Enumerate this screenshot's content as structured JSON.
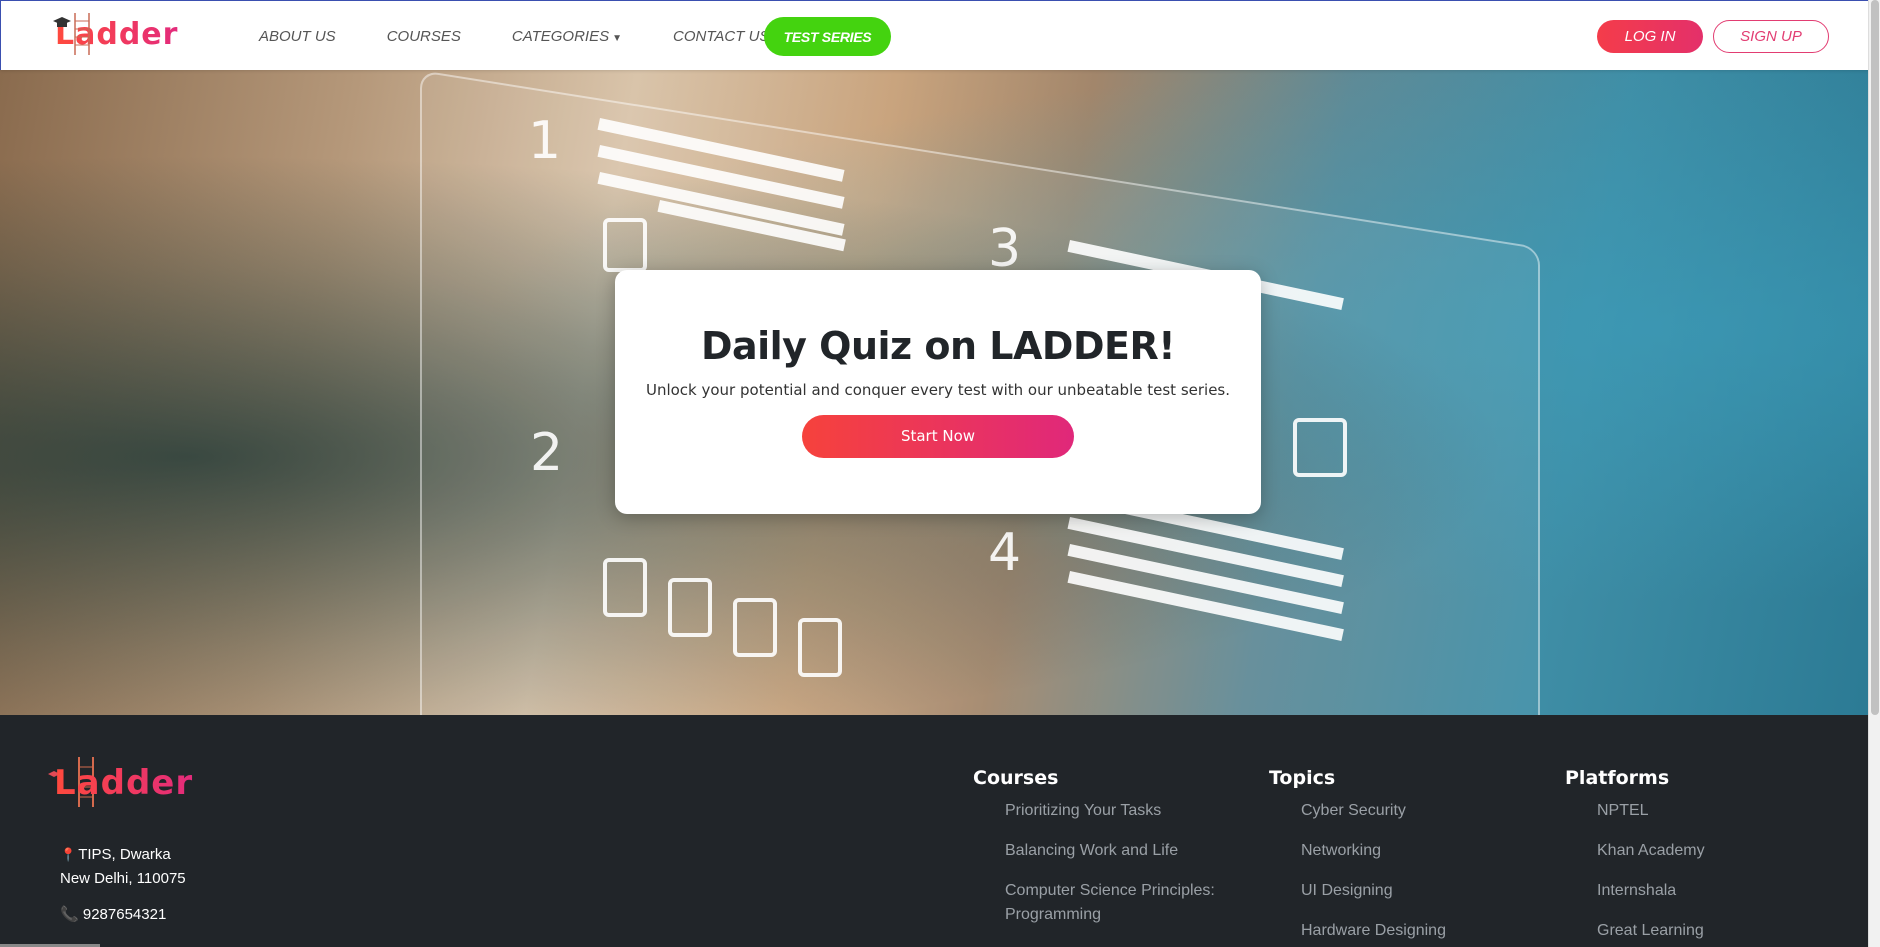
{
  "brand": {
    "name": "Ladder",
    "footer_name": "Ladder"
  },
  "nav": {
    "links": [
      {
        "label": "ABOUT US"
      },
      {
        "label": "COURSES"
      },
      {
        "label": "CATEGORIES",
        "dropdown": true
      },
      {
        "label": "CONTACT US"
      }
    ],
    "test_series_label": "TEST SERIES",
    "login_label": "LOG IN",
    "signup_label": "SIGN UP"
  },
  "hero": {
    "title": "Daily Quiz on LADDER!",
    "subtitle": "Unlock your potential and conquer every test with our unbeatable test series.",
    "cta_label": "Start Now"
  },
  "footer": {
    "address_line1": "TIPS, Dwarka",
    "address_line2": "New Delhi, 110075",
    "phone": "9287654321",
    "columns": [
      {
        "title": "Courses",
        "items": [
          "Prioritizing Your Tasks",
          "Balancing Work and Life",
          "Computer Science Principles: Programming"
        ]
      },
      {
        "title": "Topics",
        "items": [
          "Cyber Security",
          "Networking",
          "UI Designing",
          "Hardware Designing"
        ]
      },
      {
        "title": "Platforms",
        "items": [
          "NPTEL",
          "Khan Academy",
          "Internshala",
          "Great Learning"
        ]
      }
    ]
  },
  "colors": {
    "accent_green": "#44d30f",
    "accent_gradient_start": "#f6423c",
    "accent_gradient_end": "#e0287a",
    "footer_bg": "#212529"
  },
  "icons": [
    "graduation-cap-icon",
    "ladder-icon",
    "map-pin-icon",
    "phone-icon",
    "caret-down-icon"
  ]
}
